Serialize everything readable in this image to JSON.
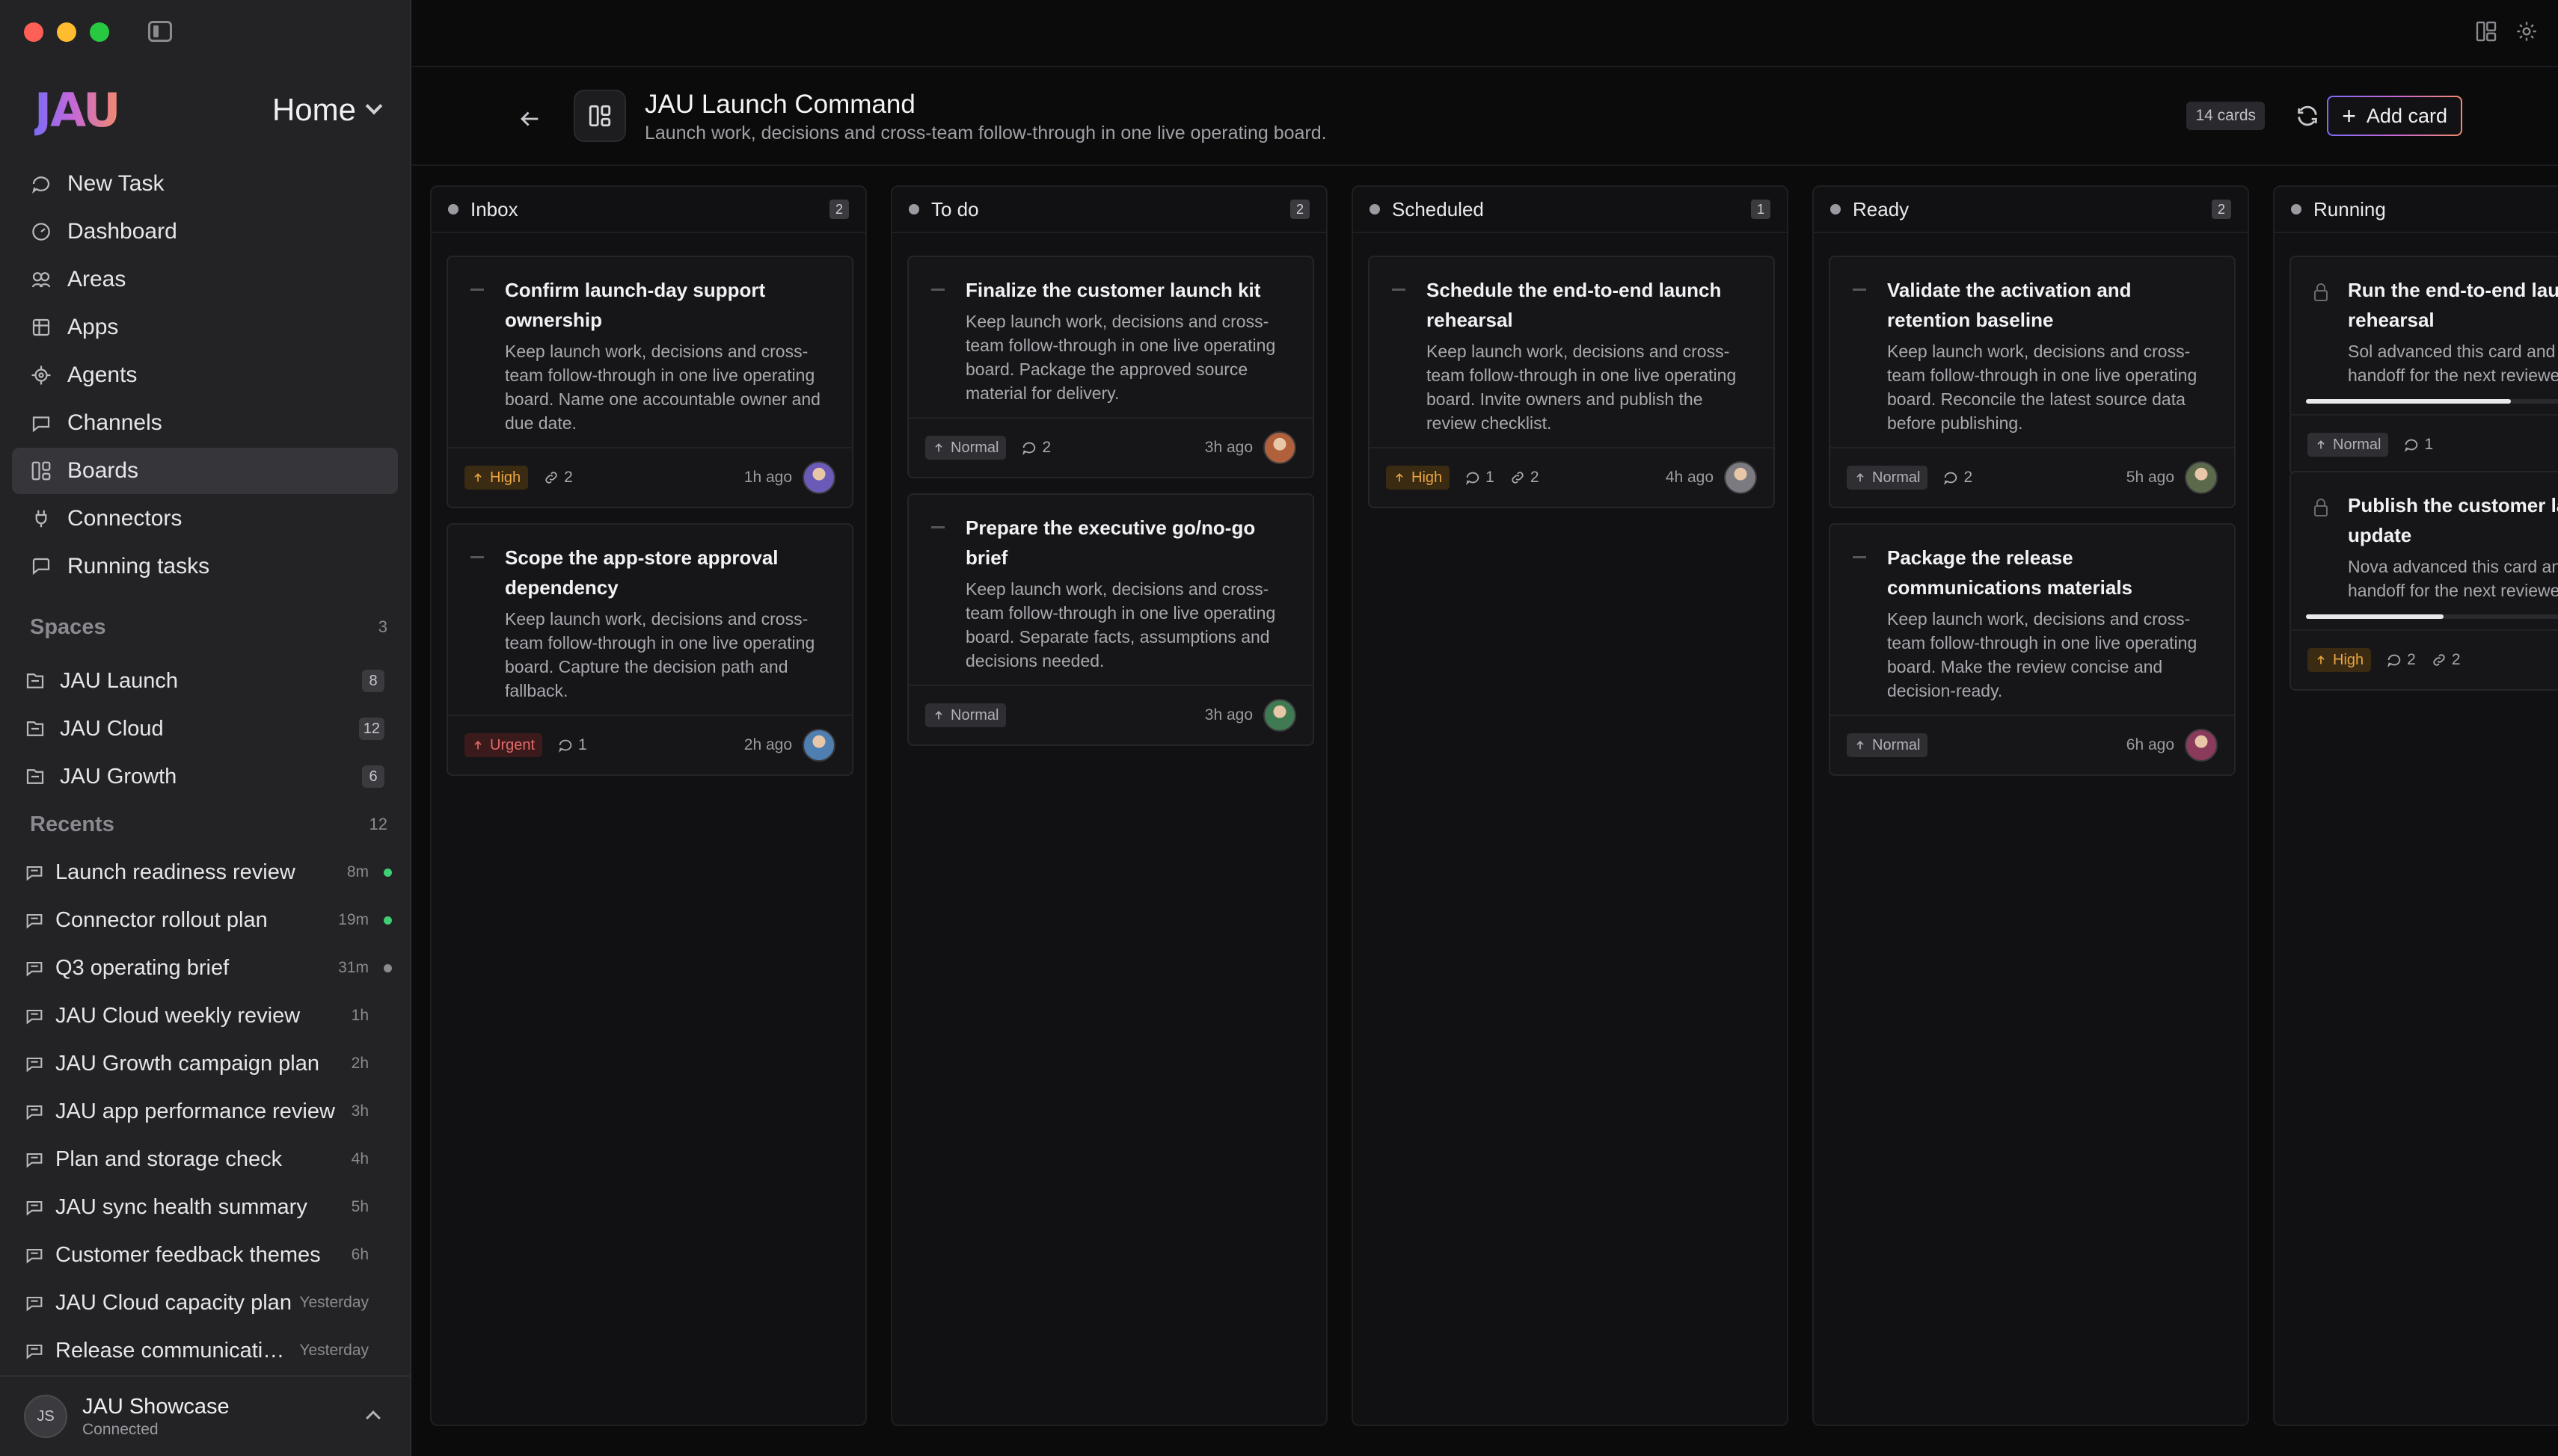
{
  "colors": {
    "accent_start": "#7c6cf6",
    "accent_mid": "#c568d8",
    "accent_end": "#f28a6a",
    "status_green": "#3ecf74",
    "status_grey": "#8a8a90"
  },
  "sidebar": {
    "logo": "JAU",
    "workspace": "Home",
    "nav": [
      {
        "label": "New Task",
        "icon": "new-chat-icon"
      },
      {
        "label": "Dashboard",
        "icon": "dashboard-icon"
      },
      {
        "label": "Areas",
        "icon": "areas-icon"
      },
      {
        "label": "Apps",
        "icon": "apps-icon"
      },
      {
        "label": "Agents",
        "icon": "agent-icon"
      },
      {
        "label": "Channels",
        "icon": "channels-icon"
      },
      {
        "label": "Boards",
        "icon": "boards-icon",
        "active": true
      },
      {
        "label": "Connectors",
        "icon": "plug-icon"
      },
      {
        "label": "Running tasks",
        "icon": "running-icon"
      }
    ],
    "spaces_header": "Spaces",
    "spaces_count": "3",
    "spaces": [
      {
        "label": "JAU Launch",
        "count": "8"
      },
      {
        "label": "JAU Cloud",
        "count": "12"
      },
      {
        "label": "JAU Growth",
        "count": "6"
      }
    ],
    "recents_header": "Recents",
    "recents_count": "12",
    "recents": [
      {
        "label": "Launch readiness review",
        "time": "8m",
        "dot": "green"
      },
      {
        "label": "Connector rollout plan",
        "time": "19m",
        "dot": "green"
      },
      {
        "label": "Q3 operating brief",
        "time": "31m",
        "dot": "grey"
      },
      {
        "label": "JAU Cloud weekly review",
        "time": "1h",
        "dot": ""
      },
      {
        "label": "JAU Growth campaign plan",
        "time": "2h",
        "dot": ""
      },
      {
        "label": "JAU app performance review",
        "time": "3h",
        "dot": ""
      },
      {
        "label": "Plan and storage check",
        "time": "4h",
        "dot": ""
      },
      {
        "label": "JAU sync health summary",
        "time": "5h",
        "dot": ""
      },
      {
        "label": "Customer feedback themes",
        "time": "6h",
        "dot": ""
      },
      {
        "label": "JAU Cloud capacity plan",
        "time": "Yesterday",
        "dot": ""
      },
      {
        "label": "Release communications plan",
        "time": "Yesterday",
        "dot": ""
      }
    ],
    "account": {
      "initials": "JS",
      "name": "JAU Showcase",
      "status": "Connected"
    }
  },
  "header": {
    "title": "JAU Launch Command",
    "subtitle": "Launch work, decisions and cross-team follow-through in one live operating board.",
    "cards_count": "14 cards",
    "add_card_label": "Add card"
  },
  "columns": [
    {
      "name": "Inbox",
      "count": "2",
      "cards": [
        {
          "title": "Confirm launch-day support ownership",
          "desc": "Keep launch work, decisions and cross-team follow-through in one live operating board. Name one accountable owner and due date.",
          "priority": "High",
          "comments": "",
          "links": "2",
          "time": "1h ago",
          "avatar": "#6b5ab8"
        },
        {
          "title": "Scope the app-store approval dependency",
          "desc": "Keep launch work, decisions and cross-team follow-through in one live operating board. Capture the decision path and fallback.",
          "priority": "Urgent",
          "comments": "1",
          "links": "",
          "time": "2h ago",
          "avatar": "#4f7fb0"
        }
      ]
    },
    {
      "name": "To do",
      "count": "2",
      "cards": [
        {
          "title": "Finalize the customer launch kit",
          "desc": "Keep launch work, decisions and cross-team follow-through in one live operating board. Package the approved source material for delivery.",
          "priority": "Normal",
          "comments": "2",
          "links": "",
          "time": "3h ago",
          "avatar": "#b0603a"
        },
        {
          "title": "Prepare the executive go/no-go brief",
          "desc": "Keep launch work, decisions and cross-team follow-through in one live operating board. Separate facts, assumptions and decisions needed.",
          "priority": "Normal",
          "comments": "",
          "links": "",
          "time": "3h ago",
          "avatar": "#3f7a52"
        }
      ]
    },
    {
      "name": "Scheduled",
      "count": "1",
      "cards": [
        {
          "title": "Schedule the end-to-end launch rehearsal",
          "desc": "Keep launch work, decisions and cross-team follow-through in one live operating board. Invite owners and publish the review checklist.",
          "priority": "High",
          "comments": "1",
          "links": "2",
          "time": "4h ago",
          "avatar": "#7a7a80"
        }
      ]
    },
    {
      "name": "Ready",
      "count": "2",
      "cards": [
        {
          "title": "Validate the activation and retention baseline",
          "desc": "Keep launch work, decisions and cross-team follow-through in one live operating board. Reconcile the latest source data before publishing.",
          "priority": "Normal",
          "comments": "2",
          "links": "",
          "time": "5h ago",
          "avatar": "#5a6a4a"
        },
        {
          "title": "Package the release communications materials",
          "desc": "Keep launch work, decisions and cross-team follow-through in one live operating board. Make the review concise and decision-ready.",
          "priority": "Normal",
          "comments": "",
          "links": "",
          "time": "6h ago",
          "avatar": "#8a3a5a"
        }
      ]
    },
    {
      "name": "Running",
      "count": "",
      "cards": [
        {
          "title": "Run the end-to-end launch rehearsal",
          "desc": "Sol advanced this card and left a concise handoff for the next reviewer.",
          "priority": "Normal",
          "comments": "1",
          "links": "",
          "progress": 0.55
        },
        {
          "title": "Publish the customer launch update",
          "desc": "Nova advanced this card and left a concise handoff for the next reviewer.",
          "priority": "High",
          "comments": "2",
          "links": "2",
          "progress": 0.37
        }
      ]
    }
  ]
}
